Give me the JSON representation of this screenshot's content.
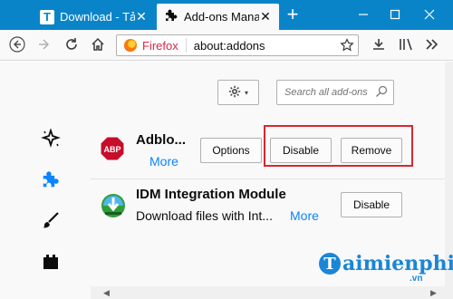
{
  "tabs": [
    {
      "title": "Download - Tải",
      "icon": "taimienphi-t-icon",
      "favicon_letter": "T"
    },
    {
      "title": "Add-ons Manager",
      "icon": "puzzle-piece-icon"
    }
  ],
  "navbar": {
    "identity_label": "Firefox",
    "url": "about:addons"
  },
  "search": {
    "placeholder": "Search all add-ons"
  },
  "addons": [
    {
      "name": "Adblo...",
      "description": "",
      "more_label": "More",
      "buttons": [
        "Options",
        "Disable",
        "Remove"
      ],
      "icon_text": "ABP"
    },
    {
      "name": "IDM Integration Module",
      "description": "Download files with Int...",
      "more_label": "More",
      "buttons": [
        "Disable"
      ]
    }
  ],
  "watermark": {
    "brand": "aimienphi",
    "letter": "T",
    "domain": ".vn"
  },
  "colors": {
    "tabbar": "#0a84c9",
    "accent": "#0a84ff",
    "highlight": "#d9272e"
  }
}
